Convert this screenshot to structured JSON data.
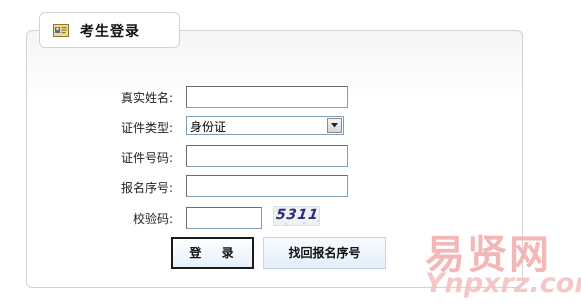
{
  "header": {
    "title": "考生登录",
    "icon": "id-card-icon"
  },
  "form": {
    "real_name": {
      "label": "真实姓名:",
      "value": ""
    },
    "id_type": {
      "label": "证件类型:",
      "selected": "身份证"
    },
    "id_number": {
      "label": "证件号码:",
      "value": ""
    },
    "reg_number": {
      "label": "报名序号:",
      "value": ""
    },
    "captcha": {
      "label": "校验码:",
      "value": "",
      "image_text": "5311"
    }
  },
  "buttons": {
    "login": "登 录",
    "find_reg_number": "找回报名序号"
  },
  "watermark": {
    "chinese": "易贤网",
    "english": "Ynpxrz.com"
  },
  "colors": {
    "border": "#d3d3d3",
    "input_border": "#7f9db9",
    "watermark": "#f2b0b0"
  }
}
